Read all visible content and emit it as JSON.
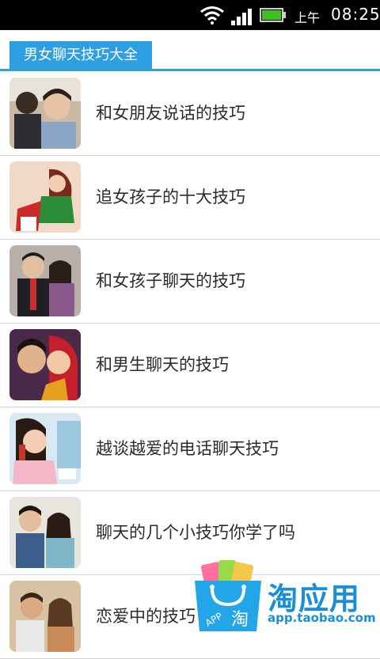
{
  "status_bar": {
    "ampm": "上午",
    "time": "08:25",
    "icons": [
      "wifi-icon",
      "signal-icon",
      "battery-icon"
    ]
  },
  "header": {
    "title": "男女聊天技巧大全",
    "accent_color": "#2e9fe0"
  },
  "list": {
    "items": [
      {
        "label": "和女朋友说话的技巧",
        "thumb": "couple-photo"
      },
      {
        "label": "追女孩子的十大技巧",
        "thumb": "woman-illustration"
      },
      {
        "label": "和女孩子聊天的技巧",
        "thumb": "couple-photo"
      },
      {
        "label": "和男生聊天的技巧",
        "thumb": "couple-photo"
      },
      {
        "label": "越谈越爱的电话聊天技巧",
        "thumb": "woman-phone-illustration"
      },
      {
        "label": "聊天的几个小技巧你学了吗",
        "thumb": "couple-photo"
      },
      {
        "label": "恋爱中的技巧 聊天",
        "thumb": "couple-photo"
      }
    ]
  },
  "watermark": {
    "title": "淘应用",
    "url": "app.taobao.com",
    "color": "#1a8fd8"
  }
}
